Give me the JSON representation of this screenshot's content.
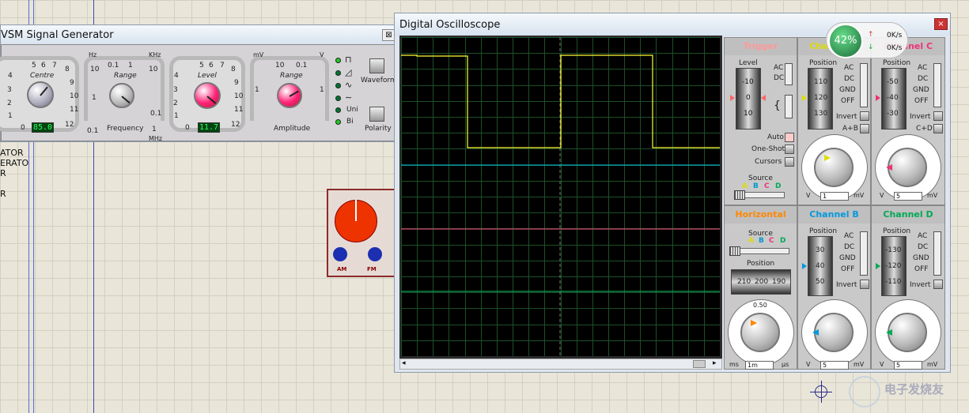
{
  "signal_generator": {
    "title": "VSM Signal Generator",
    "close": "⊠",
    "centre_label": "Centre",
    "range_label": "Range",
    "level_label": "Level",
    "frequency_label": "Frequency",
    "amplitude_label": "Amplitude",
    "centre_value": "85.0",
    "level_value": "11.7",
    "hz": "Hz",
    "khz": "KHz",
    "mhz": "MHz",
    "mv": "mV",
    "v": "V",
    "freq_range_scale": [
      "10",
      "1",
      "0.1",
      "0.1",
      "1",
      "10",
      "0.1",
      "1"
    ],
    "amp_range_scale": [
      "10",
      "0.1",
      "1",
      "1"
    ],
    "dial_scale": [
      "5",
      "6",
      "7",
      "8",
      "9",
      "10",
      "11",
      "12",
      "4",
      "3",
      "2",
      "1",
      "0"
    ],
    "waveform_label": "Waveform",
    "polarity_label": "Polarity",
    "uni": "Uni",
    "bi": "Bi"
  },
  "schematic": {
    "text_lines": [
      "ATOR",
      "ERATO",
      "R",
      "R"
    ],
    "am": "AM",
    "fm": "FM"
  },
  "oscilloscope": {
    "title": "Digital Oscilloscope",
    "close": "×",
    "trigger": {
      "title": "Trigger",
      "level": "Level",
      "ac": "AC",
      "dc": "DC",
      "level_scale": [
        "-10",
        "0",
        "10"
      ],
      "auto": "Auto",
      "one_shot": "One-Shot",
      "cursors": "Cursors",
      "source": "Source",
      "sources": [
        "A",
        "B",
        "C",
        "D"
      ]
    },
    "horizontal": {
      "title": "Horizontal",
      "source": "Source",
      "sources": [
        "A",
        "B",
        "C",
        "D"
      ],
      "position": "Position",
      "position_scale": [
        "210",
        "200",
        "190"
      ],
      "units_left": "ms",
      "units_right": "μs",
      "value": "1m",
      "dial_top": "0.50"
    },
    "channel_a": {
      "title": "Channel A",
      "position": "Position",
      "scale": [
        "110",
        "120",
        "130"
      ],
      "value": "1",
      "unit_left": "V",
      "unit_right": "mV",
      "combine": "A+B"
    },
    "channel_b": {
      "title": "Channel B",
      "position": "Position",
      "scale": [
        "30",
        "40",
        "50"
      ],
      "value": "5",
      "unit_left": "V",
      "unit_right": "mV"
    },
    "channel_c": {
      "title": "Channel C",
      "position": "Position",
      "scale": [
        "-50",
        "-40",
        "-30"
      ],
      "value": "5",
      "unit_left": "V",
      "unit_right": "mV",
      "combine": "C+D"
    },
    "channel_d": {
      "title": "Channel D",
      "position": "Position",
      "scale": [
        "-130",
        "-120",
        "-110"
      ],
      "value": "5",
      "unit_left": "V",
      "unit_right": "mV"
    },
    "coupling": [
      "AC",
      "DC",
      "GND",
      "OFF"
    ],
    "invert": "Invert",
    "colors": {
      "a": "#ffff00",
      "b": "#00c8e6",
      "c": "#ff3c8c",
      "d": "#00c864",
      "trigger": "#ff8080",
      "horizontal": "#ff8800"
    }
  },
  "net_meter": {
    "percent": "42%",
    "up": "0K/s",
    "down": "0K/s"
  },
  "watermark": "电子发烧友"
}
